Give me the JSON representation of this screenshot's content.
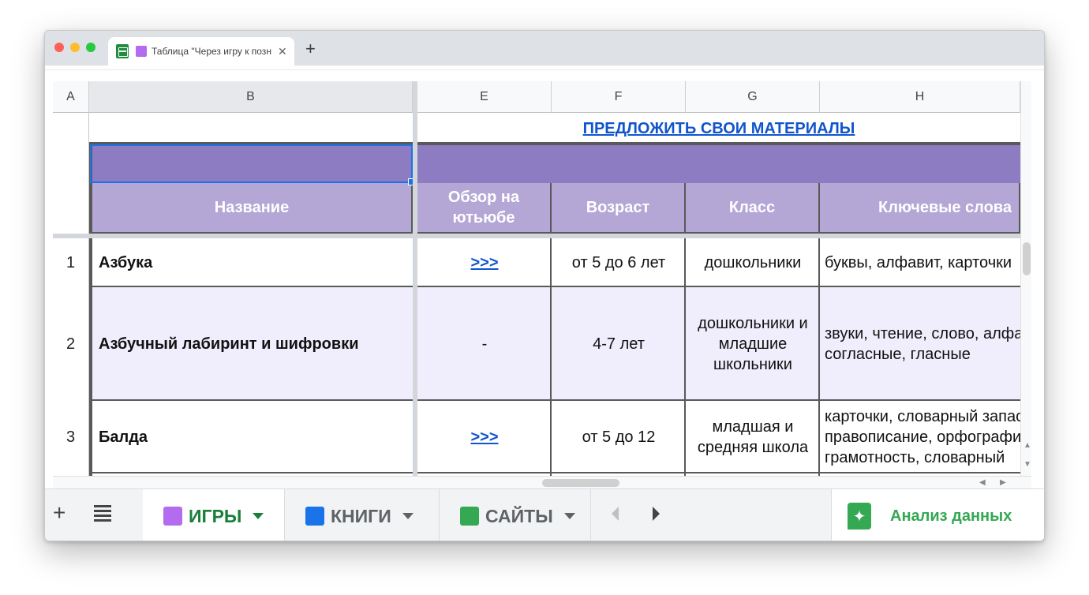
{
  "browser": {
    "tab_title": "Таблица \"Через игру к познанию\"",
    "close_glyph": "✕",
    "newtab_glyph": "+"
  },
  "columns": [
    "A",
    "B",
    "E",
    "F",
    "G",
    "H"
  ],
  "banner_link": "ПРЕДЛОЖИТЬ СВОИ МАТЕРИАЛЫ",
  "headers": {
    "name": "Название",
    "review": "Обзор на ютьюбе",
    "age": "Возраст",
    "grade": "Класс",
    "keywords": "Ключевые слова"
  },
  "rows": [
    {
      "num": "1",
      "name": "Азбука",
      "review": ">>>",
      "age": "от 5 до 6 лет",
      "grade": "дошкольники",
      "keywords": "буквы, алфавит, карточки"
    },
    {
      "num": "2",
      "name": "Азбучный лабиринт и шифровки",
      "review": "-",
      "age": "4-7 лет",
      "grade": "дошкольники и младшие школьники",
      "keywords": "звуки, чтение, слово, алфавит,\nсогласные, гласные"
    },
    {
      "num": "3",
      "name": "Балда",
      "review": ">>>",
      "age": "от 5 до 12",
      "grade": "младшая и средняя школа",
      "keywords": "карточки, словарный запас,\nправописание, орфография,\nграмотность, словарный"
    }
  ],
  "sheet_tabs": [
    {
      "label": "ИГРЫ",
      "color": "#b36bef",
      "active": true
    },
    {
      "label": "КНИГИ",
      "color": "#1a73e8",
      "active": false
    },
    {
      "label": "САЙТЫ",
      "color": "#34a853",
      "active": false
    }
  ],
  "toolbar": {
    "add": "+"
  },
  "explore": {
    "label": "Анализ данных",
    "icon": "explore-icon"
  },
  "colors": {
    "band": "#8e7cc3",
    "header": "#b4a7d6",
    "row_alt": "#f0edfc",
    "link": "#1155cc",
    "accent": "#188038"
  }
}
